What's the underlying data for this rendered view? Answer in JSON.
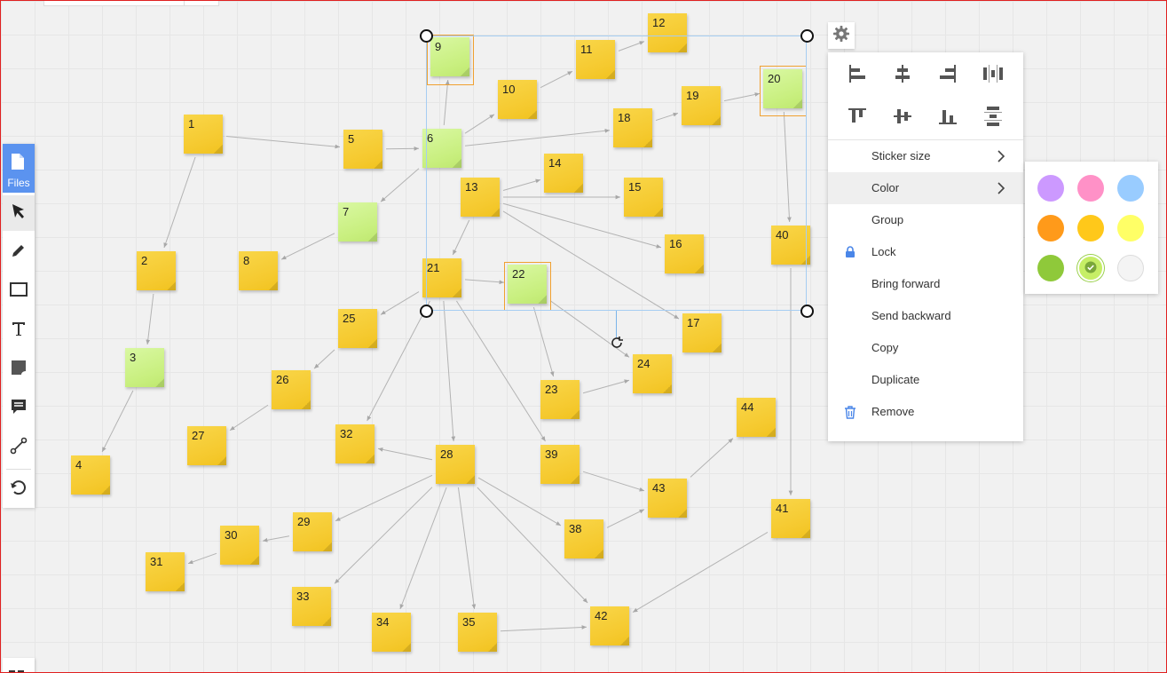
{
  "toolbar": {
    "files_label": "Files",
    "tools": [
      "pointer-icon",
      "pencil-icon",
      "rectangle-icon",
      "text-icon",
      "sticker-icon",
      "comment-icon",
      "connector-icon",
      "undo-icon"
    ]
  },
  "stickies": [
    {
      "label": "1",
      "color": "yellow"
    },
    {
      "label": "2",
      "color": "yellow"
    },
    {
      "label": "3",
      "color": "green"
    },
    {
      "label": "4",
      "color": "yellow"
    },
    {
      "label": "5",
      "color": "yellow"
    },
    {
      "label": "6",
      "color": "green"
    },
    {
      "label": "7",
      "color": "green"
    },
    {
      "label": "8",
      "color": "yellow"
    },
    {
      "label": "9",
      "color": "green"
    },
    {
      "label": "10",
      "color": "yellow"
    },
    {
      "label": "11",
      "color": "yellow"
    },
    {
      "label": "12",
      "color": "yellow"
    },
    {
      "label": "13",
      "color": "yellow"
    },
    {
      "label": "14",
      "color": "yellow"
    },
    {
      "label": "15",
      "color": "yellow"
    },
    {
      "label": "16",
      "color": "yellow"
    },
    {
      "label": "17",
      "color": "yellow"
    },
    {
      "label": "18",
      "color": "yellow"
    },
    {
      "label": "19",
      "color": "yellow"
    },
    {
      "label": "20",
      "color": "green"
    },
    {
      "label": "21",
      "color": "yellow"
    },
    {
      "label": "22",
      "color": "green"
    },
    {
      "label": "23",
      "color": "yellow"
    },
    {
      "label": "24",
      "color": "yellow"
    },
    {
      "label": "25",
      "color": "yellow"
    },
    {
      "label": "26",
      "color": "yellow"
    },
    {
      "label": "27",
      "color": "yellow"
    },
    {
      "label": "28",
      "color": "yellow"
    },
    {
      "label": "29",
      "color": "yellow"
    },
    {
      "label": "30",
      "color": "yellow"
    },
    {
      "label": "31",
      "color": "yellow"
    },
    {
      "label": "32",
      "color": "yellow"
    },
    {
      "label": "33",
      "color": "yellow"
    },
    {
      "label": "34",
      "color": "yellow"
    },
    {
      "label": "35",
      "color": "yellow"
    },
    {
      "label": "38",
      "color": "yellow"
    },
    {
      "label": "39",
      "color": "yellow"
    },
    {
      "label": "40",
      "color": "yellow"
    },
    {
      "label": "41",
      "color": "yellow"
    },
    {
      "label": "42",
      "color": "yellow"
    },
    {
      "label": "43",
      "color": "yellow"
    },
    {
      "label": "44",
      "color": "yellow"
    }
  ],
  "connections": [
    [
      "1",
      "5"
    ],
    [
      "1",
      "2"
    ],
    [
      "2",
      "3"
    ],
    [
      "3",
      "4"
    ],
    [
      "5",
      "6"
    ],
    [
      "6",
      "9"
    ],
    [
      "6",
      "10"
    ],
    [
      "6",
      "18"
    ],
    [
      "6",
      "7"
    ],
    [
      "7",
      "8"
    ],
    [
      "10",
      "11"
    ],
    [
      "11",
      "12"
    ],
    [
      "13",
      "14"
    ],
    [
      "13",
      "15"
    ],
    [
      "13",
      "16"
    ],
    [
      "13",
      "17"
    ],
    [
      "13",
      "21"
    ],
    [
      "18",
      "19"
    ],
    [
      "19",
      "20"
    ],
    [
      "20",
      "40"
    ],
    [
      "21",
      "22"
    ],
    [
      "21",
      "25"
    ],
    [
      "21",
      "32"
    ],
    [
      "21",
      "28"
    ],
    [
      "21",
      "39"
    ],
    [
      "22",
      "23"
    ],
    [
      "22",
      "24"
    ],
    [
      "23",
      "24"
    ],
    [
      "25",
      "26"
    ],
    [
      "26",
      "27"
    ],
    [
      "28",
      "32"
    ],
    [
      "28",
      "29"
    ],
    [
      "28",
      "33"
    ],
    [
      "28",
      "34"
    ],
    [
      "28",
      "35"
    ],
    [
      "28",
      "38"
    ],
    [
      "28",
      "42"
    ],
    [
      "29",
      "30"
    ],
    [
      "30",
      "31"
    ],
    [
      "35",
      "42"
    ],
    [
      "38",
      "43"
    ],
    [
      "39",
      "43"
    ],
    [
      "43",
      "44"
    ],
    [
      "40",
      "41"
    ],
    [
      "41",
      "42"
    ]
  ],
  "context_menu": {
    "align_tools": [
      "align-left-icon",
      "align-center-horizontal-icon",
      "align-right-icon",
      "distribute-horizontal-icon",
      "align-top-icon",
      "align-middle-vertical-icon",
      "align-bottom-icon",
      "distribute-vertical-icon"
    ],
    "items": [
      {
        "label": "Sticker size",
        "submenu": true
      },
      {
        "label": "Color",
        "submenu": true,
        "highlighted": true
      },
      {
        "label": "Group"
      },
      {
        "label": "Lock",
        "icon": "lock-icon"
      },
      {
        "label": "Bring forward"
      },
      {
        "label": "Send backward"
      },
      {
        "label": "Copy"
      },
      {
        "label": "Duplicate"
      },
      {
        "label": "Remove",
        "icon": "trash-icon"
      }
    ]
  },
  "color_options": [
    {
      "name": "purple",
      "hex": "#cc99ff"
    },
    {
      "name": "pink",
      "hex": "#ff91c7"
    },
    {
      "name": "blue",
      "hex": "#99ccff"
    },
    {
      "name": "orange",
      "hex": "#ff9a1a"
    },
    {
      "name": "amber",
      "hex": "#ffc81a"
    },
    {
      "name": "yellow",
      "hex": "#ffff66"
    },
    {
      "name": "green",
      "hex": "#8fc93a"
    },
    {
      "name": "light-green",
      "hex": "#c6ee66",
      "selected": true
    },
    {
      "name": "white",
      "hex": "#f4f4f4"
    }
  ],
  "colors": {
    "accent": "#5b93ef",
    "selection": "#a6cdf2",
    "sticky_yellow": "#f5c92e",
    "sticky_green": "#c8ef7e"
  }
}
